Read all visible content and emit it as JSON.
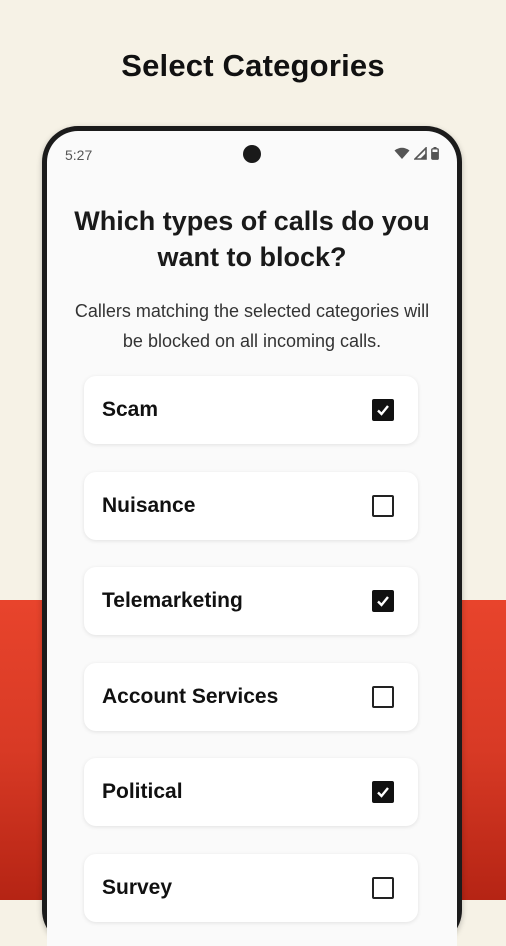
{
  "promo": {
    "title": "Select Categories"
  },
  "status_bar": {
    "time": "5:27"
  },
  "screen": {
    "question": "Which types of calls do you want to block?",
    "subtitle": "Callers matching the selected categories will be blocked on all incoming calls."
  },
  "categories": [
    {
      "label": "Scam",
      "checked": true
    },
    {
      "label": "Nuisance",
      "checked": false
    },
    {
      "label": "Telemarketing",
      "checked": true
    },
    {
      "label": "Account Services",
      "checked": false
    },
    {
      "label": "Political",
      "checked": true
    },
    {
      "label": "Survey",
      "checked": false
    }
  ],
  "icons": {
    "wifi": "wifi-icon",
    "signal": "signal-icon",
    "battery": "battery-icon",
    "camera": "front-camera-icon",
    "check": "checkmark-icon"
  },
  "colors": {
    "background_top": "#f6f2e6",
    "background_bottom": "#e8442c",
    "checkbox_checked": "#111111"
  }
}
